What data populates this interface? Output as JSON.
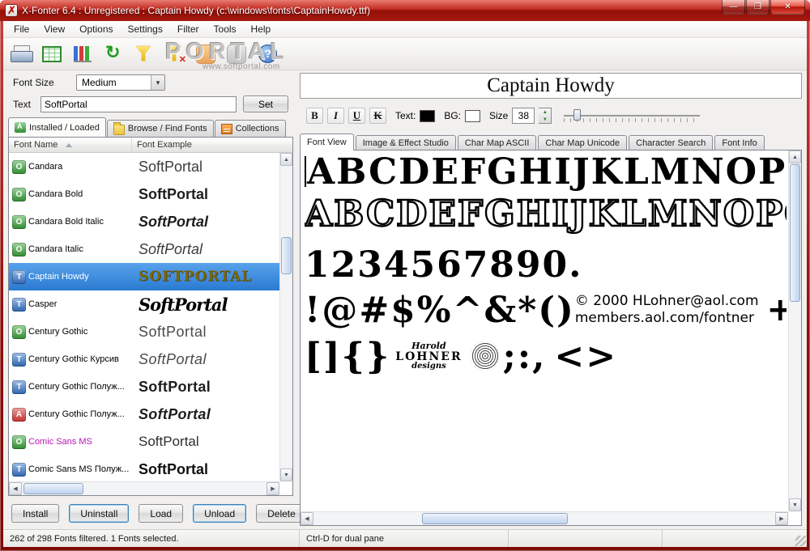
{
  "window": {
    "title": "X-Fonter 6.4 : Unregistered : Captain Howdy (c:\\windows\\fonts\\CaptainHowdy.ttf)",
    "controls": {
      "minimize": "—",
      "maximize": "❐",
      "close": "✕"
    }
  },
  "menu": {
    "items": [
      "File",
      "View",
      "Options",
      "Settings",
      "Filter",
      "Tools",
      "Help"
    ]
  },
  "toolbar": {
    "icons": [
      "print",
      "font-table",
      "library",
      "refresh",
      "filter",
      "filter-clear",
      "puzzle-orange",
      "puzzle-gray",
      "help"
    ],
    "watermark": {
      "text": "PORTAL",
      "subtext": "www.softportal.com"
    }
  },
  "left_panel": {
    "font_size_label": "Font Size",
    "font_size_value": "Medium",
    "text_label": "Text",
    "text_value": "SoftPortal",
    "set_button": "Set",
    "tabs": [
      {
        "label": "Installed / Loaded",
        "icon": "installed-fonts",
        "active": true
      },
      {
        "label": "Browse / Find Fonts",
        "icon": "browse-folder",
        "active": false
      },
      {
        "label": "Collections",
        "icon": "collections",
        "active": false
      }
    ],
    "table": {
      "columns": [
        "Font Name",
        "Font Example"
      ],
      "rows": [
        {
          "name": "Candara",
          "example": "SoftPortal",
          "icon": "O",
          "icon_color": "green",
          "style": "regular"
        },
        {
          "name": "Candara Bold",
          "example": "SoftPortal",
          "icon": "O",
          "icon_color": "green",
          "style": "bold"
        },
        {
          "name": "Candara Bold Italic",
          "example": "SoftPortal",
          "icon": "O",
          "icon_color": "green",
          "style": "bold-italic"
        },
        {
          "name": "Candara Italic",
          "example": "SoftPortal",
          "icon": "O",
          "icon_color": "green",
          "style": "italic"
        },
        {
          "name": "Captain Howdy",
          "example": "SOFTPORTAL",
          "icon": "T",
          "icon_color": "blue",
          "style": "captain",
          "selected": true
        },
        {
          "name": "Casper",
          "example": "SoftPortal",
          "icon": "T",
          "icon_color": "blue",
          "style": "casper"
        },
        {
          "name": "Century Gothic",
          "example": "SoftPortal",
          "icon": "O",
          "icon_color": "green",
          "style": "gothic"
        },
        {
          "name": "Century Gothic Курсив",
          "example": "SoftPortal",
          "icon": "T",
          "icon_color": "blue",
          "style": "gothic-italic"
        },
        {
          "name": "Century Gothic Полуж...",
          "example": "SoftPortal",
          "icon": "T",
          "icon_color": "blue",
          "style": "gothic-bold"
        },
        {
          "name": "Century Gothic Полуж...",
          "example": "SoftPortal",
          "icon": "A",
          "icon_color": "red",
          "style": "gothic-bold-italic"
        },
        {
          "name": "Comic Sans MS",
          "example": "SoftPortal",
          "icon": "O",
          "icon_color": "green",
          "style": "comic",
          "name_color": "#b515b5"
        },
        {
          "name": "Comic Sans MS Полуж...",
          "example": "SoftPortal",
          "icon": "T",
          "icon_color": "blue",
          "style": "comic-bold"
        }
      ]
    },
    "buttons": [
      {
        "label": "Install"
      },
      {
        "label": "Uninstall",
        "focused": true
      },
      {
        "label": "Load"
      },
      {
        "label": "Unload",
        "focused": true
      },
      {
        "label": "Delete"
      }
    ]
  },
  "right_panel": {
    "title": "Captain Howdy",
    "format": {
      "bold": "B",
      "italic": "I",
      "underline": "U",
      "strike": "K",
      "text_label": "Text:",
      "bg_label": "BG:",
      "size_label": "Size",
      "size_value": "38"
    },
    "tabs": [
      {
        "label": "Font View",
        "active": true
      },
      {
        "label": "Image & Effect Studio"
      },
      {
        "label": "Char Map ASCII"
      },
      {
        "label": "Char Map Unicode"
      },
      {
        "label": "Character Search"
      },
      {
        "label": "Font Info"
      }
    ],
    "preview": {
      "line1": "ABCDEFGHIJKLMNOPQ",
      "line2": "ABCDEFGHIJKLMNOPQ",
      "line3": "1234567890.",
      "line4": {
        "glyphs": "!@#$%^&*()",
        "credit1": "© 2000 HLohner@aol.com",
        "credit2": "members.aol.com/fontner",
        "plus": "+"
      },
      "line5": {
        "open": "[]{}",
        "logo1": "Harold",
        "logo2": "LOHNER",
        "logo3": "designs",
        "punct": ";:,",
        "angles": "<>"
      }
    }
  },
  "status": {
    "left": "262 of 298 Fonts filtered.  1 Fonts selected.",
    "middle": "Ctrl-D for dual pane"
  },
  "colors": {
    "titlebar_red": "#a51a10",
    "selection_blue": "#2a7ad2",
    "captain_gold": "#7d6504",
    "comic_name_purple": "#b515b5"
  }
}
